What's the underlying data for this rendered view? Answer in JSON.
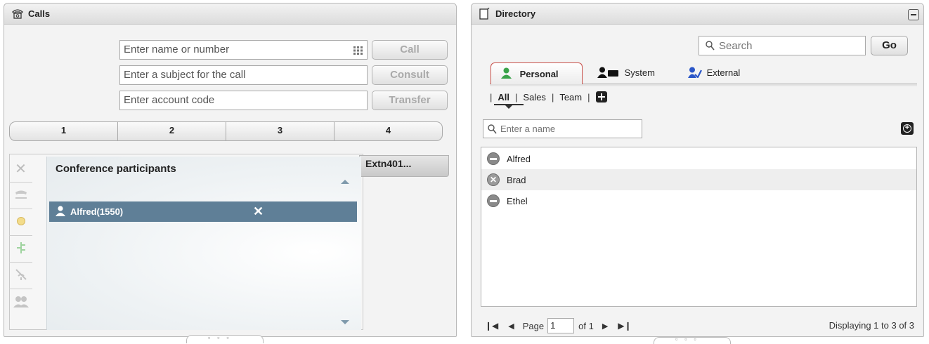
{
  "calls": {
    "title": "Calls",
    "name_placeholder": "Enter name or number",
    "subject_placeholder": "Enter a subject for the call",
    "account_placeholder": "Enter account code",
    "call_label": "Call",
    "consult_label": "Consult",
    "transfer_label": "Transfer",
    "lines": [
      "1",
      "2",
      "3",
      "4"
    ],
    "extension_tab": "Extn401...",
    "conference": {
      "title": "Conference participants",
      "participants": [
        {
          "name": "Alfred(1550)"
        }
      ]
    },
    "toolbar_icons": [
      "close-icon",
      "hangup-icon",
      "hold-icon",
      "transfer-tree-icon",
      "mute-icon",
      "conference-icon"
    ]
  },
  "directory": {
    "title": "Directory",
    "search_placeholder": "Search",
    "go_label": "Go",
    "tabs": [
      {
        "label": "Personal",
        "icon": "person-green-icon",
        "active": true
      },
      {
        "label": "System",
        "icon": "system-users-icon",
        "active": false
      },
      {
        "label": "External",
        "icon": "external-users-icon",
        "active": false
      }
    ],
    "subtabs": [
      "All",
      "Sales",
      "Team"
    ],
    "filter_placeholder": "Enter a name",
    "contacts": [
      {
        "name": "Alfred",
        "status": "dash"
      },
      {
        "name": "Brad",
        "status": "x"
      },
      {
        "name": "Ethel",
        "status": "dash"
      }
    ],
    "pager": {
      "page_label": "Page",
      "page_value": "1",
      "of_label": "of 1",
      "summary": "Displaying 1 to 3 of 3"
    }
  },
  "colors": {
    "participant_row": "#5f7f97",
    "personal_tab_border": "#c8504a",
    "header_bg": "#dcdcdc"
  }
}
